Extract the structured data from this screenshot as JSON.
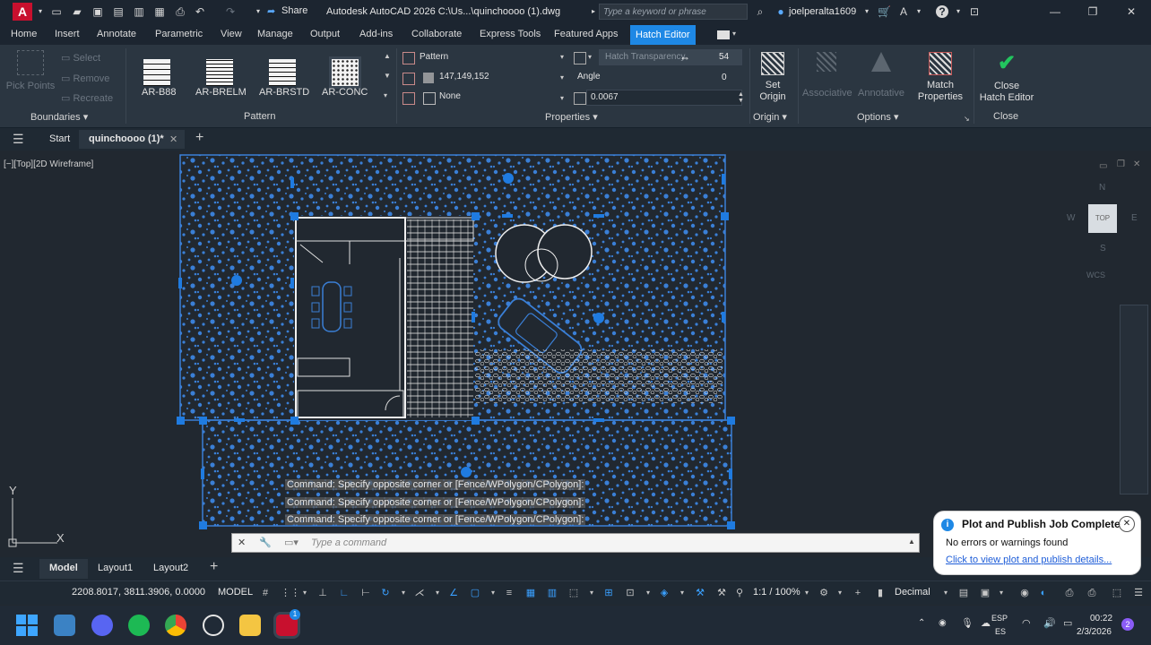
{
  "titlebar": {
    "app_letter": "A",
    "share_label": "Share",
    "title": "Autodesk AutoCAD 2026   C:\\Us...\\quinchoooo (1).dwg",
    "search_placeholder": "Type a keyword or phrase",
    "user": "joelperalta1609"
  },
  "tabs": [
    "Home",
    "Insert",
    "Annotate",
    "Parametric",
    "View",
    "Manage",
    "Output",
    "Add-ins",
    "Collaborate",
    "Express Tools",
    "Featured Apps",
    "Hatch Editor"
  ],
  "ribbon": {
    "boundaries": {
      "pick_points": "Pick Points",
      "select": "Select",
      "remove": "Remove",
      "recreate": "Recreate",
      "footer": "Boundaries"
    },
    "pattern": {
      "items": [
        "AR-B88",
        "AR-BRELM",
        "AR-BRSTD",
        "AR-CONC"
      ],
      "footer": "Pattern"
    },
    "properties": {
      "type": "Pattern",
      "color": "147,149,152",
      "background": "None",
      "transparency_label": "Hatch Transparency",
      "transparency_value": "54",
      "angle_label": "Angle",
      "angle_value": "0",
      "scale_value": "0.0067",
      "footer": "Properties"
    },
    "origin": {
      "set_origin": "Set\nOrigin",
      "footer": "Origin"
    },
    "options": {
      "associative": "Associative",
      "annotative": "Annotative",
      "match_properties": "Match\nProperties",
      "footer": "Options"
    },
    "close": {
      "label": "Close\nHatch Editor",
      "footer": "Close"
    }
  },
  "filetabs": {
    "start": "Start",
    "active": "quinchoooo (1)*"
  },
  "viewport": {
    "label": "[−][Top][2D Wireframe]",
    "wcs": "WCS",
    "top": "TOP",
    "n": "N",
    "s": "S",
    "e": "E",
    "w": "W"
  },
  "command_history": [
    "Command: Specify opposite corner or [Fence/WPolygon/CPolygon]:",
    "Command: Specify opposite corner or [Fence/WPolygon/CPolygon]:",
    "Command: Specify opposite corner or [Fence/WPolygon/CPolygon]:"
  ],
  "command_placeholder": "Type a command",
  "layout_tabs": [
    "Model",
    "Layout1",
    "Layout2"
  ],
  "statusbar": {
    "coords": "2208.8017, 3811.3906, 0.0000",
    "model": "MODEL",
    "scale": "1:1 / 100%",
    "units": "Decimal"
  },
  "notification": {
    "title": "Plot and Publish Job Complete",
    "body": "No errors or warnings found",
    "link": "Click to view plot and publish details..."
  },
  "taskbar": {
    "lang": "ESP",
    "lang2": "ES",
    "time": "00:22",
    "date": "2/3/2026",
    "badge": "1",
    "notif_count": "2"
  },
  "colors": {
    "accent": "#1e88e5",
    "hatch": "#3a7fd6",
    "grip": "#1f7be0",
    "close_check": "#22c55e"
  }
}
